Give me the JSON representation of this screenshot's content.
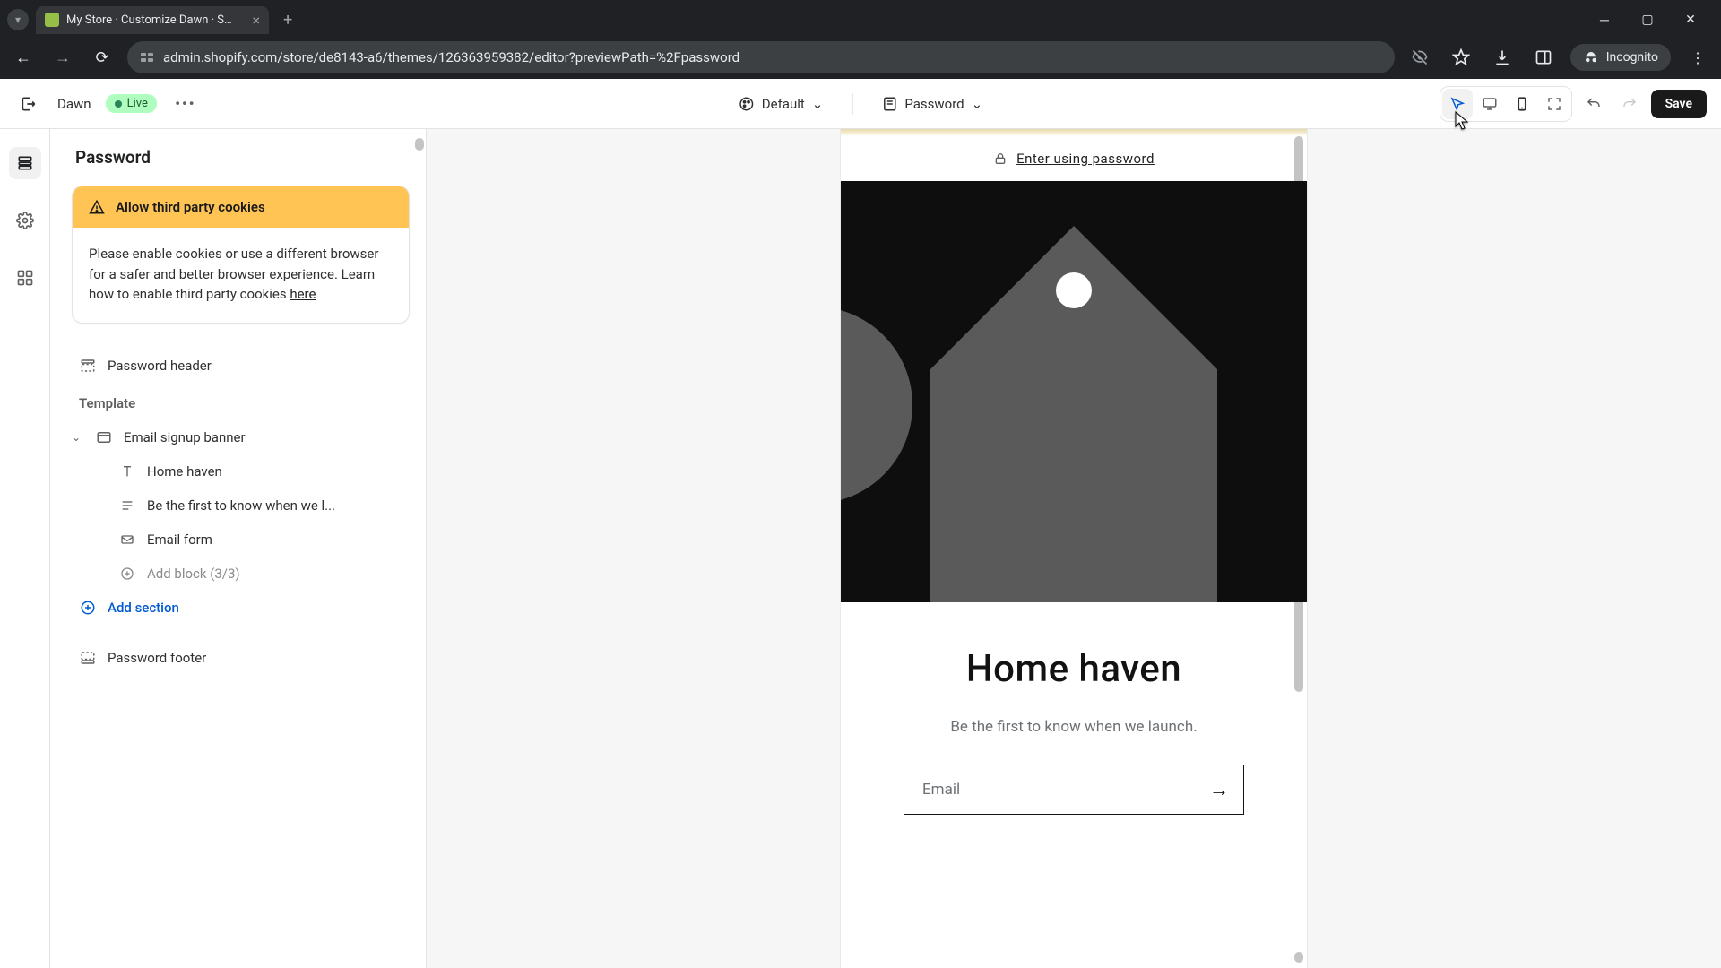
{
  "browser": {
    "tab_title": "My Store · Customize Dawn · S…",
    "url": "admin.shopify.com/store/de8143-a6/themes/126363959382/editor?previewPath=%2Fpassword",
    "incognito_label": "Incognito"
  },
  "topbar": {
    "theme_name": "Dawn",
    "live_label": "Live",
    "style_dropdown": "Default",
    "page_dropdown": "Password",
    "save_label": "Save"
  },
  "sidebar": {
    "title": "Password",
    "alert": {
      "heading": "Allow third party cookies",
      "body_prefix": "Please enable cookies or use a different browser for a safer and better browser experience. Learn how to enable third party cookies ",
      "link": "here"
    },
    "rows": {
      "password_header": "Password header",
      "template": "Template",
      "email_signup": "Email signup banner",
      "home_haven": "Home haven",
      "be_first": "Be the first to know when we l...",
      "email_form": "Email form",
      "add_block": "Add block (3/3)",
      "add_section": "Add section",
      "password_footer": "Password footer"
    }
  },
  "preview": {
    "enter_password": "Enter using password",
    "hero_title": "Home haven",
    "hero_sub": "Be the first to know when we launch.",
    "email_placeholder": "Email"
  }
}
